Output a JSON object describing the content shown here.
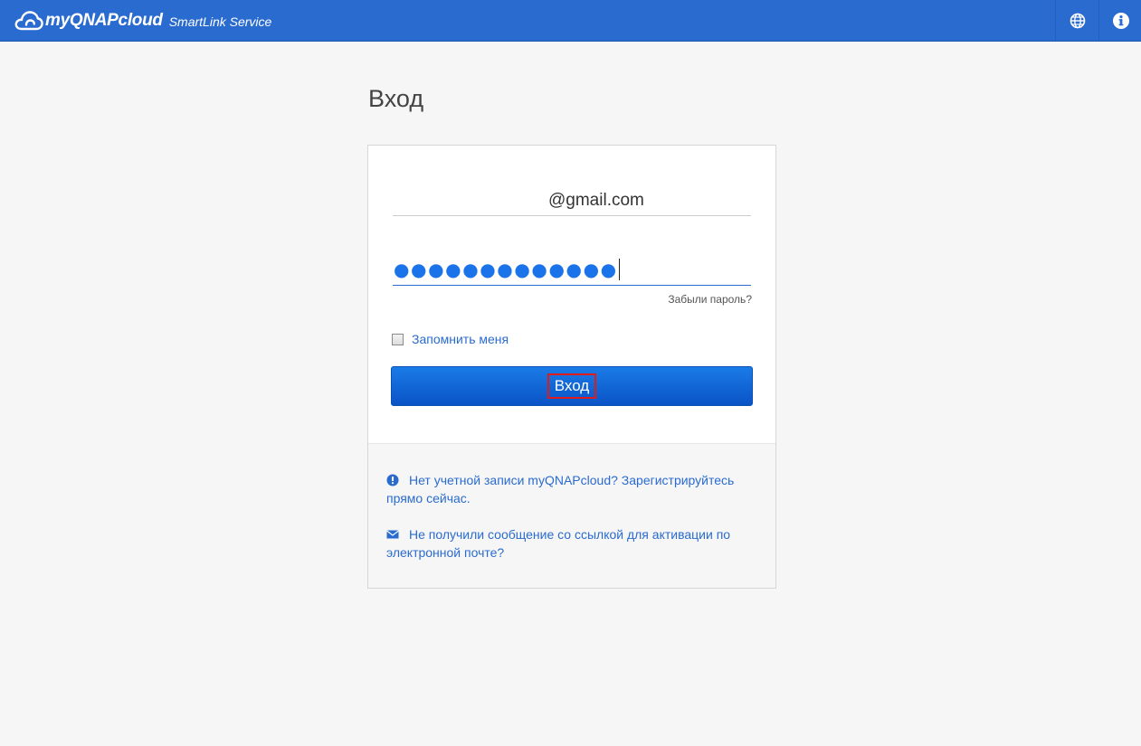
{
  "header": {
    "brand_name": "myQNAPcloud",
    "brand_subtitle": "SmartLink Service",
    "language_icon": "globe-icon",
    "info_icon": "info-icon",
    "background_color": "#2a6bd0"
  },
  "page": {
    "title": "Вход"
  },
  "form": {
    "email_value": "@gmail.com",
    "password_masked": "●●●●●●●●●●●●●",
    "forgot_password": "Забыли пароль?",
    "remember_me": "Запомнить меня",
    "remember_checked": false,
    "login_button": "Вход",
    "button_color": "#0a63d6"
  },
  "footer": {
    "register_text": "Нет учетной записи myQNAPcloud? Зарегистрируйтесь прямо сейчас.",
    "register_icon": "exclamation-circle-icon",
    "activation_text": "Не получили сообщение со ссылкой для активации по электронной почте?",
    "activation_icon": "envelope-icon"
  }
}
